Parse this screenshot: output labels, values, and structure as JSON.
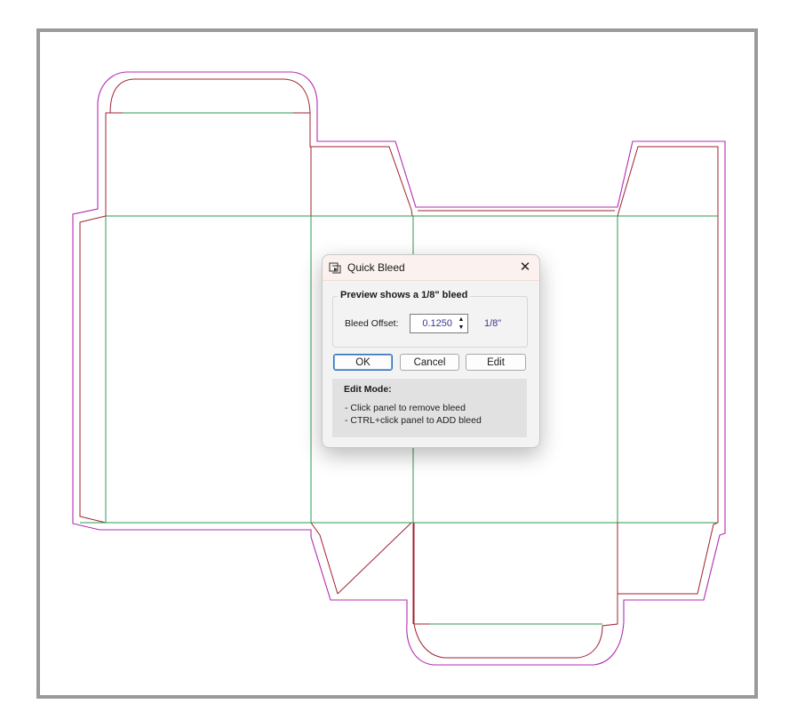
{
  "dialog": {
    "title": "Quick Bleed",
    "close_label": "✕",
    "group_title": "Preview shows a 1/8\" bleed",
    "offset_label": "Bleed Offset:",
    "offset_value": "0.1250",
    "spin_up": "▲",
    "spin_down": "▼",
    "fraction_label": "1/8\"",
    "ok_label": "OK",
    "cancel_label": "Cancel",
    "edit_label": "Edit",
    "edit_mode_title": "Edit Mode:",
    "edit_mode_lines": [
      "- Click panel to remove bleed",
      "- CTRL+click panel to ADD bleed"
    ]
  },
  "colors": {
    "cut_line": "#a02030",
    "fold_line": "#2e9a4e",
    "bleed_line": "#b02cb0",
    "frame_border": "#9a9a9a"
  }
}
